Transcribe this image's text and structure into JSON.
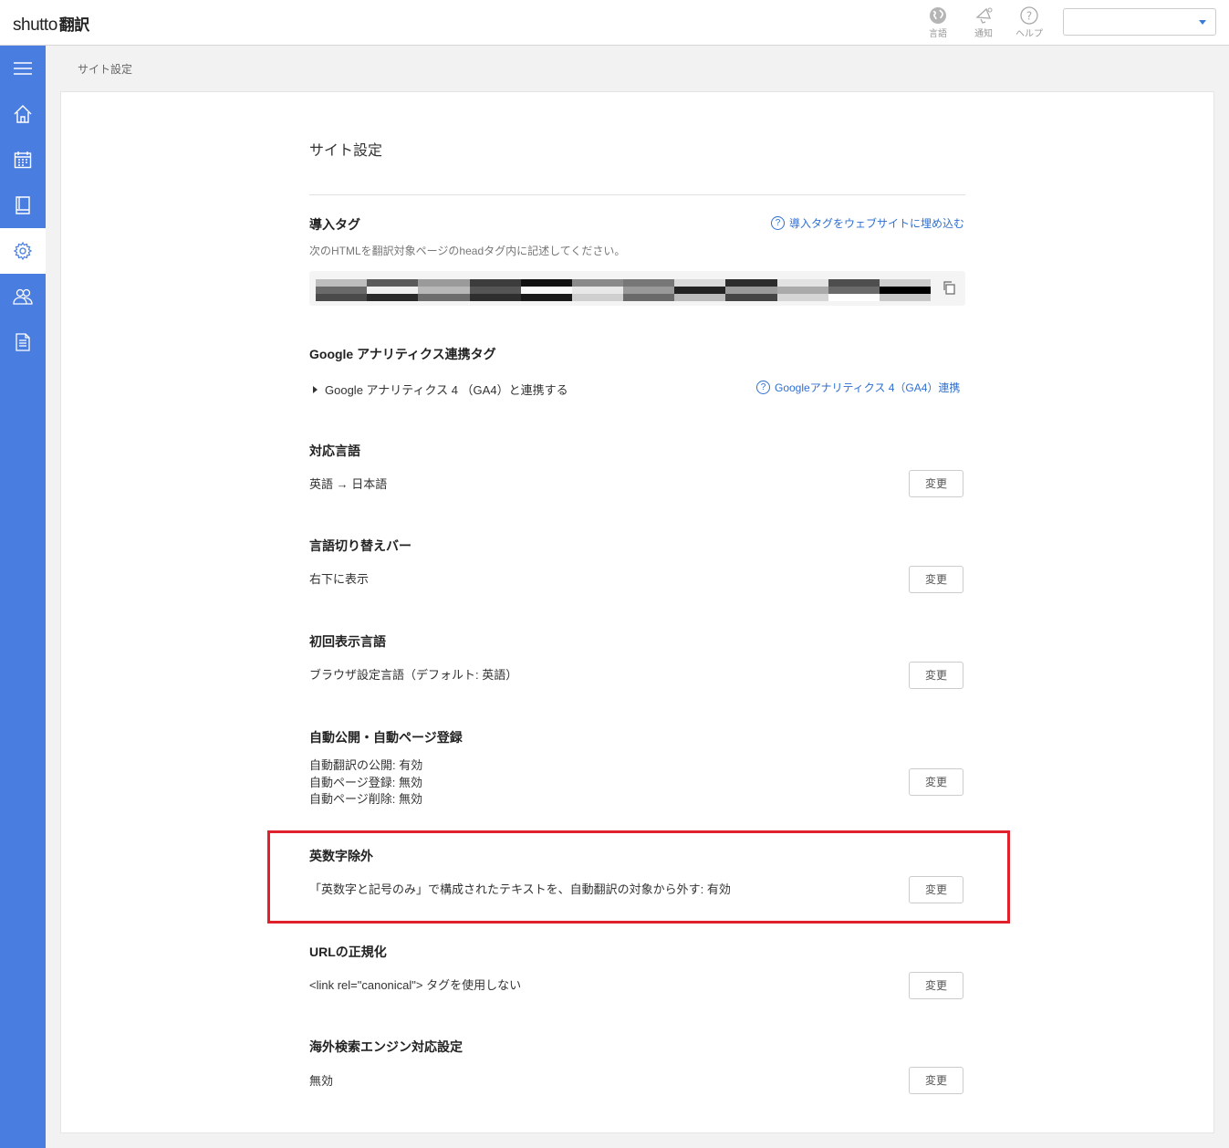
{
  "header": {
    "logo_text": "shutto",
    "logo_kanji": "翻訳",
    "icons": [
      {
        "name": "globe-icon",
        "label": "言語"
      },
      {
        "name": "bell-icon",
        "label": "通知"
      },
      {
        "name": "help-icon",
        "label": "ヘルプ"
      }
    ],
    "account_select_value": ""
  },
  "sidebar": {
    "items": [
      {
        "name": "menu-icon",
        "active": false
      },
      {
        "name": "home-icon",
        "active": false
      },
      {
        "name": "calendar-icon",
        "active": false
      },
      {
        "name": "book-icon",
        "active": false
      },
      {
        "name": "gear-icon",
        "active": true
      },
      {
        "name": "users-icon",
        "active": false
      },
      {
        "name": "document-icon",
        "active": false
      }
    ]
  },
  "breadcrumb": "サイト設定",
  "page_title": "サイト設定",
  "sections": {
    "tag": {
      "title": "導入タグ",
      "description": "次のHTMLを翻訳対象ページのheadタグ内に記述してください。",
      "help_link": "導入タグをウェブサイトに埋め込む"
    },
    "ga": {
      "title": "Google アナリティクス連携タグ",
      "expander": "Google アナリティクス 4 （GA4）と連携する",
      "help_link": "Googleアナリティクス 4（GA4）連携"
    },
    "languages": {
      "title": "対応言語",
      "value": "英語 → 日本語",
      "button": "変更"
    },
    "switcher": {
      "title": "言語切り替えバー",
      "value": "右下に表示",
      "button": "変更"
    },
    "initial_lang": {
      "title": "初回表示言語",
      "value": "ブラウザ設定言語（デフォルト: 英語）",
      "button": "変更"
    },
    "auto_publish": {
      "title": "自動公開・自動ページ登録",
      "lines": [
        "自動翻訳の公開: 有効",
        "自動ページ登録: 無効",
        "自動ページ削除: 無効"
      ],
      "button": "変更"
    },
    "alnum_exclude": {
      "title": "英数字除外",
      "value": "「英数字と記号のみ」で構成されたテキストを、自動翻訳の対象から外す: 有効",
      "button": "変更"
    },
    "canonical": {
      "title": "URLの正規化",
      "value": "<link rel=\"canonical\"> タグを使用しない",
      "button": "変更"
    },
    "seo": {
      "title": "海外検索エンジン対応設定",
      "value": "無効",
      "button": "変更"
    }
  },
  "colors": {
    "sidebar": "#4a7de0",
    "link": "#2f6fd0",
    "highlight": "#e0202a"
  }
}
